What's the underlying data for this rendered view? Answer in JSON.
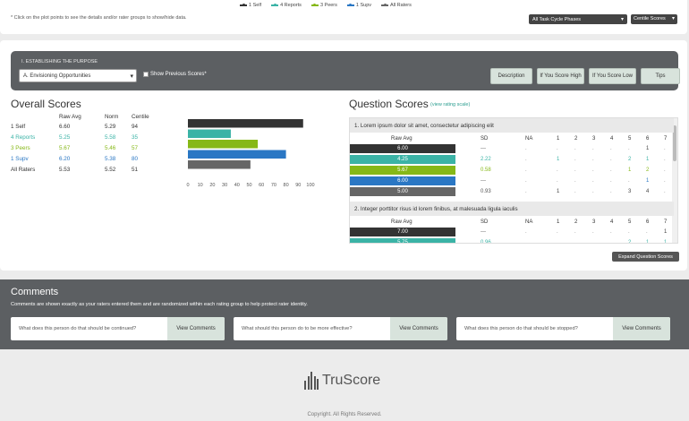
{
  "legend": [
    {
      "label": "1 Self",
      "color": "#333333"
    },
    {
      "label": "4 Reports",
      "color": "#3bb3a6"
    },
    {
      "label": "3 Peers",
      "color": "#86b817"
    },
    {
      "label": "1 Supv",
      "color": "#2a77c4"
    },
    {
      "label": "All Raters",
      "color": "#666666"
    }
  ],
  "hint": "* Click on the plot points to see the details and/or rater groups to show/hide data.",
  "phase_select": "All Task Cycle Phases",
  "score_select": "Centile Scores",
  "purpose": {
    "label": "I. ESTABLISHING THE PURPOSE",
    "selected": "A. Envisioning Opportunities",
    "show_previous": "Show Previous Scores*",
    "buttons": [
      "Description",
      "If You Score High",
      "If You Score Low",
      "Tips"
    ]
  },
  "overall": {
    "title": "Overall Scores",
    "headers": [
      "Raw Avg",
      "Norm",
      "Centile"
    ],
    "rows": [
      {
        "name": "1 Self",
        "raw": "6.60",
        "norm": "5.29",
        "centile": "94",
        "color": "#333333"
      },
      {
        "name": "4 Reports",
        "raw": "5.25",
        "norm": "5.58",
        "centile": "35",
        "color": "#3bb3a6"
      },
      {
        "name": "3 Peers",
        "raw": "5.67",
        "norm": "5.46",
        "centile": "57",
        "color": "#86b817"
      },
      {
        "name": "1 Supv",
        "raw": "6.20",
        "norm": "5.38",
        "centile": "80",
        "color": "#2a77c4"
      },
      {
        "name": "All Raters",
        "raw": "5.53",
        "norm": "5.52",
        "centile": "51",
        "color": "#333333"
      }
    ]
  },
  "chart_data": {
    "type": "bar",
    "orientation": "horizontal",
    "categories": [
      "1 Self",
      "4 Reports",
      "3 Peers",
      "1 Supv",
      "All Raters"
    ],
    "values": [
      94,
      35,
      57,
      80,
      51
    ],
    "colors": [
      "#333333",
      "#3bb3a6",
      "#86b817",
      "#2a77c4",
      "#666666"
    ],
    "ticks": [
      "0",
      "10",
      "20",
      "30",
      "40",
      "50",
      "60",
      "70",
      "80",
      "90",
      "100"
    ],
    "xlim": [
      0,
      100
    ]
  },
  "questions": {
    "title": "Question Scores",
    "rating_link": "(view rating scale)",
    "columns": [
      "Raw Avg",
      "SD",
      "NA",
      "1",
      "2",
      "3",
      "4",
      "5",
      "6",
      "7"
    ],
    "items": [
      {
        "text": "1. Lorem ipsum dolor sit amet, consectetur adipiscing elit",
        "rows": [
          {
            "raw": "6.00",
            "sd": "---",
            "na": ".",
            "c": [
              ".",
              ".",
              ".",
              ".",
              ".",
              "1",
              "."
            ],
            "color": "#333333"
          },
          {
            "raw": "4.25",
            "sd": "2.22",
            "na": ".",
            "c": [
              "1",
              ".",
              ".",
              ".",
              "2",
              "1",
              "."
            ],
            "color": "#3bb3a6"
          },
          {
            "raw": "5.67",
            "sd": "0.58",
            "na": ".",
            "c": [
              ".",
              ".",
              ".",
              ".",
              "1",
              "2",
              "."
            ],
            "color": "#86b817"
          },
          {
            "raw": "6.00",
            "sd": "---",
            "na": ".",
            "c": [
              ".",
              ".",
              ".",
              ".",
              ".",
              "1",
              "."
            ],
            "color": "#2a77c4"
          },
          {
            "raw": "5.00",
            "sd": "0.93",
            "na": ".",
            "c": [
              "1",
              ".",
              ".",
              ".",
              "3",
              "4",
              "."
            ],
            "color": "#666666"
          }
        ]
      },
      {
        "text": "2. Integer porttitor risus id lorem finibus, at malesuada ligula iaculis",
        "rows": [
          {
            "raw": "7.00",
            "sd": "---",
            "na": ".",
            "c": [
              ".",
              ".",
              ".",
              ".",
              ".",
              ".",
              "1"
            ],
            "color": "#333333"
          },
          {
            "raw": "5.75",
            "sd": "0.96",
            "na": ".",
            "c": [
              ".",
              ".",
              ".",
              ".",
              "2",
              "1",
              "1"
            ],
            "color": "#3bb3a6"
          }
        ]
      }
    ],
    "expand_button": "Expand Question Scores"
  },
  "comments": {
    "title": "Comments",
    "description": "Comments are shown exactly as your raters entered them and are randomized within each rating group to help protect rater identity.",
    "boxes": [
      {
        "question": "What does this person do that should be continued?",
        "button": "View Comments"
      },
      {
        "question": "What should this person do to be more effective?",
        "button": "View Comments"
      },
      {
        "question": "What does this person do that should be stopped?",
        "button": "View Comments"
      }
    ]
  },
  "footer": {
    "logo_text": "TruScore",
    "copyright": "Copyright. All Rights Reserved."
  }
}
